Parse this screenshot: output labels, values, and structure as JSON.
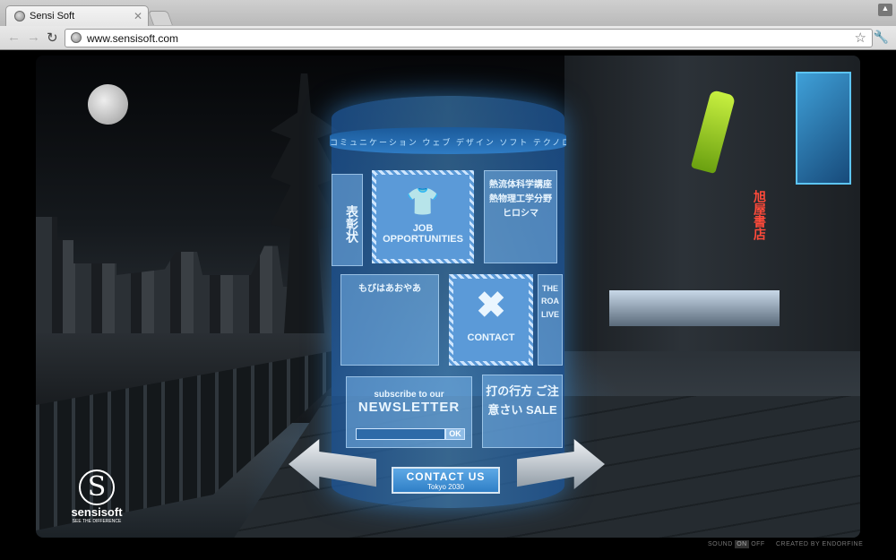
{
  "browser": {
    "tab_title": "Sensi Soft",
    "url": "www.sensisoft.com"
  },
  "site": {
    "ring_text": "コミュニケーション ウェブ デザイン ソフト テクノロジー 未来",
    "panels": {
      "job": "JOB OPPORTUNITIES",
      "award": "表彰状",
      "jp_card": "熱流体科学講座 熱物理工学分野 ヒロシマ",
      "letter": "もびはあおやあ",
      "contact": "CONTACT",
      "side": "THE ROA LIVE",
      "notice": "打の行方 ご注意さい SALE"
    },
    "newsletter": {
      "subtitle": "subscribe to our",
      "title": "NEWSLETTER",
      "ok": "OK"
    },
    "contact_us": {
      "title": "CONTACT US",
      "subtitle": "Tokyo 2030"
    },
    "logo": {
      "name": "sensisoft",
      "tagline": "SEE THE DIFFERENCE"
    },
    "shop_sign": "旭屋書店",
    "footer": {
      "sound": "SOUND",
      "on": "ON",
      "off": "OFF",
      "credit": "CREATED BY ENDORFINE"
    }
  }
}
